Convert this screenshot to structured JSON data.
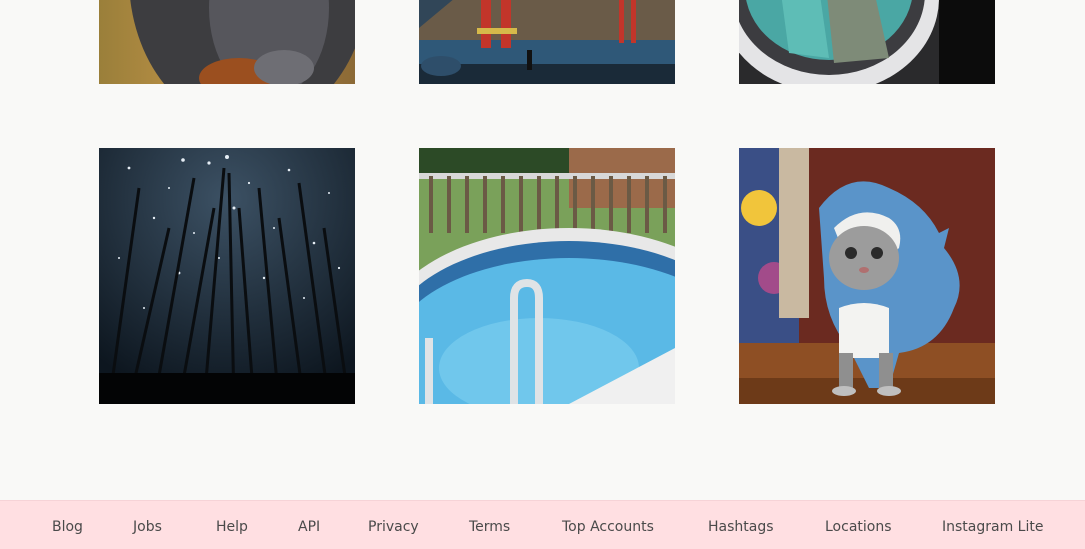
{
  "gallery": {
    "tiles": [
      {
        "subject": "dog-photo"
      },
      {
        "subject": "golden-gate-bridge-photo"
      },
      {
        "subject": "airplane-window-photo"
      },
      {
        "subject": "starry-forest-photo"
      },
      {
        "subject": "swimming-pool-photo"
      },
      {
        "subject": "cat-in-shark-costume-photo"
      }
    ]
  },
  "footer": {
    "links": [
      "Blog",
      "Jobs",
      "Help",
      "API",
      "Privacy",
      "Terms",
      "Top Accounts",
      "Hashtags",
      "Locations",
      "Instagram Lite"
    ]
  },
  "colors": {
    "page_background": "#f9f9f7",
    "footer_background": "#ffdfe2",
    "footer_text": "#4a4a4a"
  }
}
